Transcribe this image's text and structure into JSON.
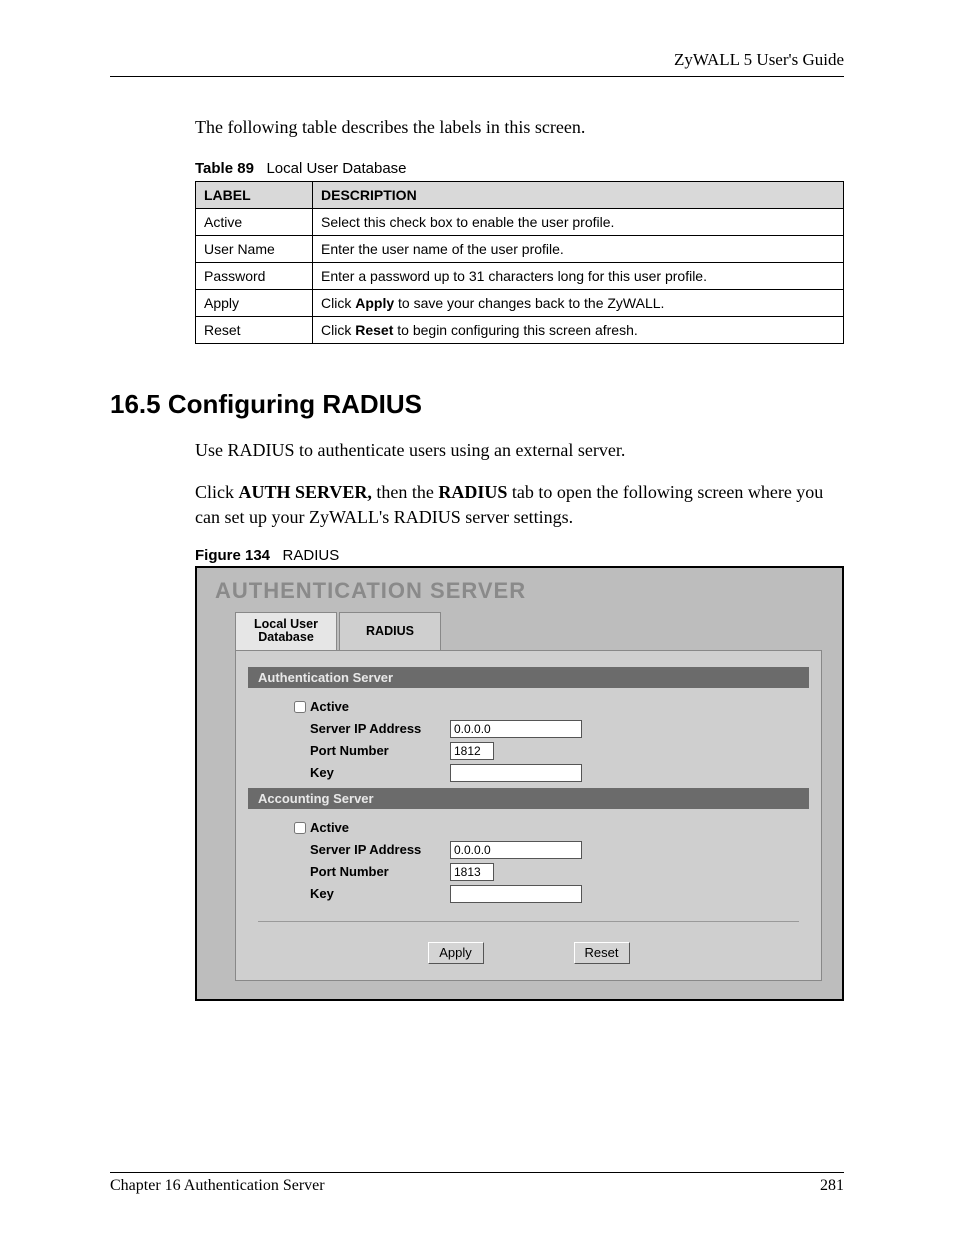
{
  "header": {
    "guide_title": "ZyWALL 5 User's Guide"
  },
  "intro_text": "The following table describes the labels in this screen.",
  "table89": {
    "caption_label": "Table 89",
    "caption_text": "Local User Database",
    "head_label": "LABEL",
    "head_desc": "DESCRIPTION",
    "rows": [
      {
        "label": "Active",
        "desc_pre": "",
        "desc_bold": "",
        "desc_post": "Select this check box to enable the user profile."
      },
      {
        "label": "User Name",
        "desc_pre": "",
        "desc_bold": "",
        "desc_post": "Enter the user name of the user profile."
      },
      {
        "label": "Password",
        "desc_pre": "",
        "desc_bold": "",
        "desc_post": "Enter a password up to 31 characters long for this user profile."
      },
      {
        "label": "Apply",
        "desc_pre": "Click ",
        "desc_bold": "Apply",
        "desc_post": " to save your changes back to the ZyWALL."
      },
      {
        "label": "Reset",
        "desc_pre": "Click ",
        "desc_bold": "Reset",
        "desc_post": " to begin configuring this screen afresh."
      }
    ]
  },
  "section": {
    "heading": "16.5  Configuring RADIUS",
    "p1": "Use RADIUS to authenticate users using an external server.",
    "p2_pre": "Click ",
    "p2_b1": "AUTH SERVER,",
    "p2_mid": " then the ",
    "p2_b2": "RADIUS",
    "p2_post": " tab to open the following screen where you can set up your ZyWALL's RADIUS server settings."
  },
  "figure": {
    "caption_label": "Figure 134",
    "caption_text": "RADIUS",
    "screen_title": "AUTHENTICATION SERVER",
    "tab1": "Local User\nDatabase",
    "tab2": "RADIUS",
    "group1": "Authentication Server",
    "group2": "Accounting Server",
    "lbl_active": "Active",
    "lbl_ip": "Server IP Address",
    "lbl_port": "Port Number",
    "lbl_key": "Key",
    "auth": {
      "ip": "0.0.0.0",
      "port": "1812",
      "key": ""
    },
    "acct": {
      "ip": "0.0.0.0",
      "port": "1813",
      "key": ""
    },
    "btn_apply": "Apply",
    "btn_reset": "Reset"
  },
  "footer": {
    "chapter": "Chapter 16 Authentication Server",
    "page": "281"
  }
}
